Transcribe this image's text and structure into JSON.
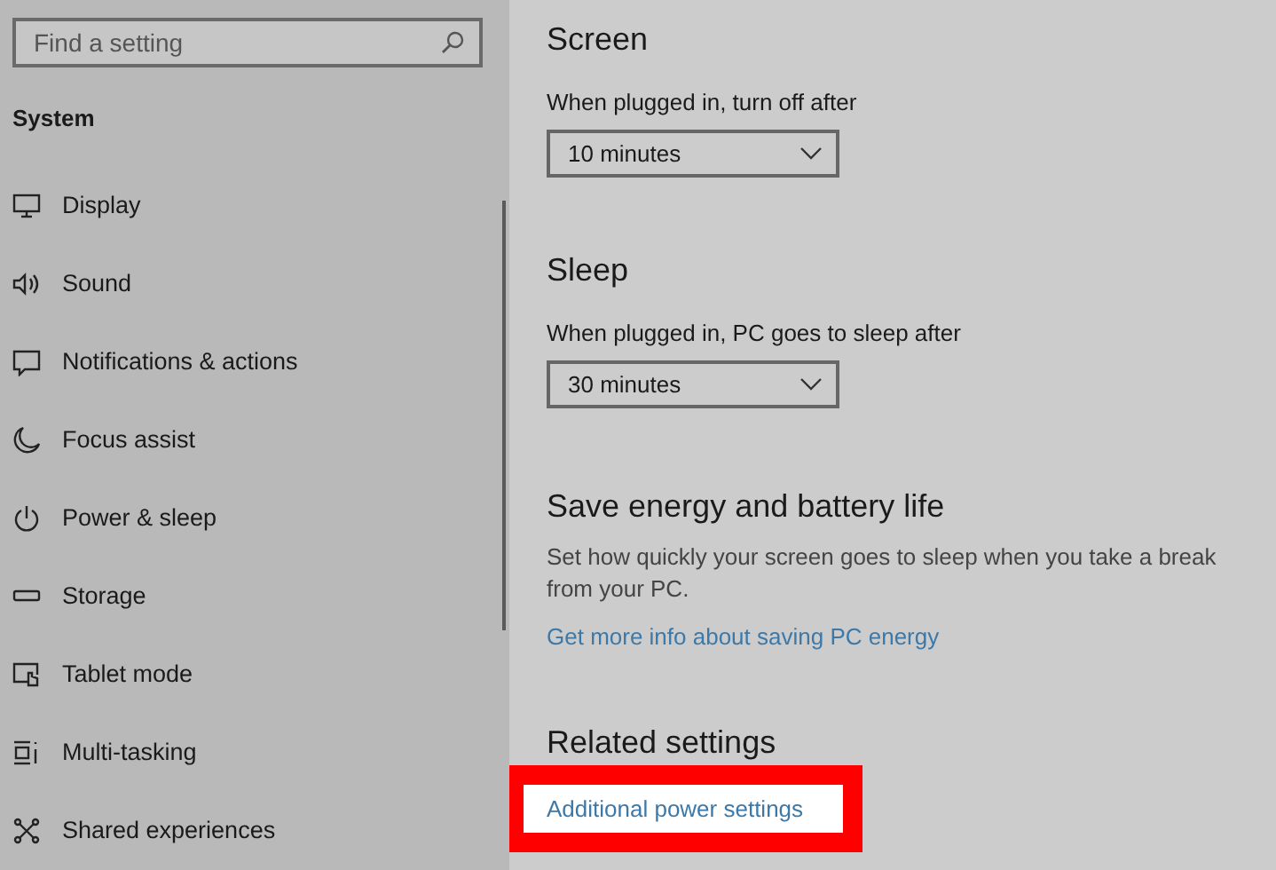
{
  "search": {
    "placeholder": "Find a setting"
  },
  "sidebar": {
    "heading": "System",
    "items": [
      {
        "label": "Display"
      },
      {
        "label": "Sound"
      },
      {
        "label": "Notifications & actions"
      },
      {
        "label": "Focus assist"
      },
      {
        "label": "Power & sleep"
      },
      {
        "label": "Storage"
      },
      {
        "label": "Tablet mode"
      },
      {
        "label": "Multi-tasking"
      },
      {
        "label": "Shared experiences"
      }
    ]
  },
  "sections": [
    {
      "heading": "Screen",
      "label": "When plugged in, turn off after",
      "dropdown": "10 minutes"
    },
    {
      "heading": "Sleep",
      "label": "When plugged in, PC goes to sleep after",
      "dropdown": "30 minutes"
    }
  ],
  "save_energy": {
    "heading": "Save energy and battery life",
    "description": "Set how quickly your screen goes to sleep when you take a break from your PC.",
    "link": "Get more info about saving PC energy"
  },
  "related": {
    "heading": "Related settings",
    "link": "Additional power settings",
    "highlighted": true
  }
}
